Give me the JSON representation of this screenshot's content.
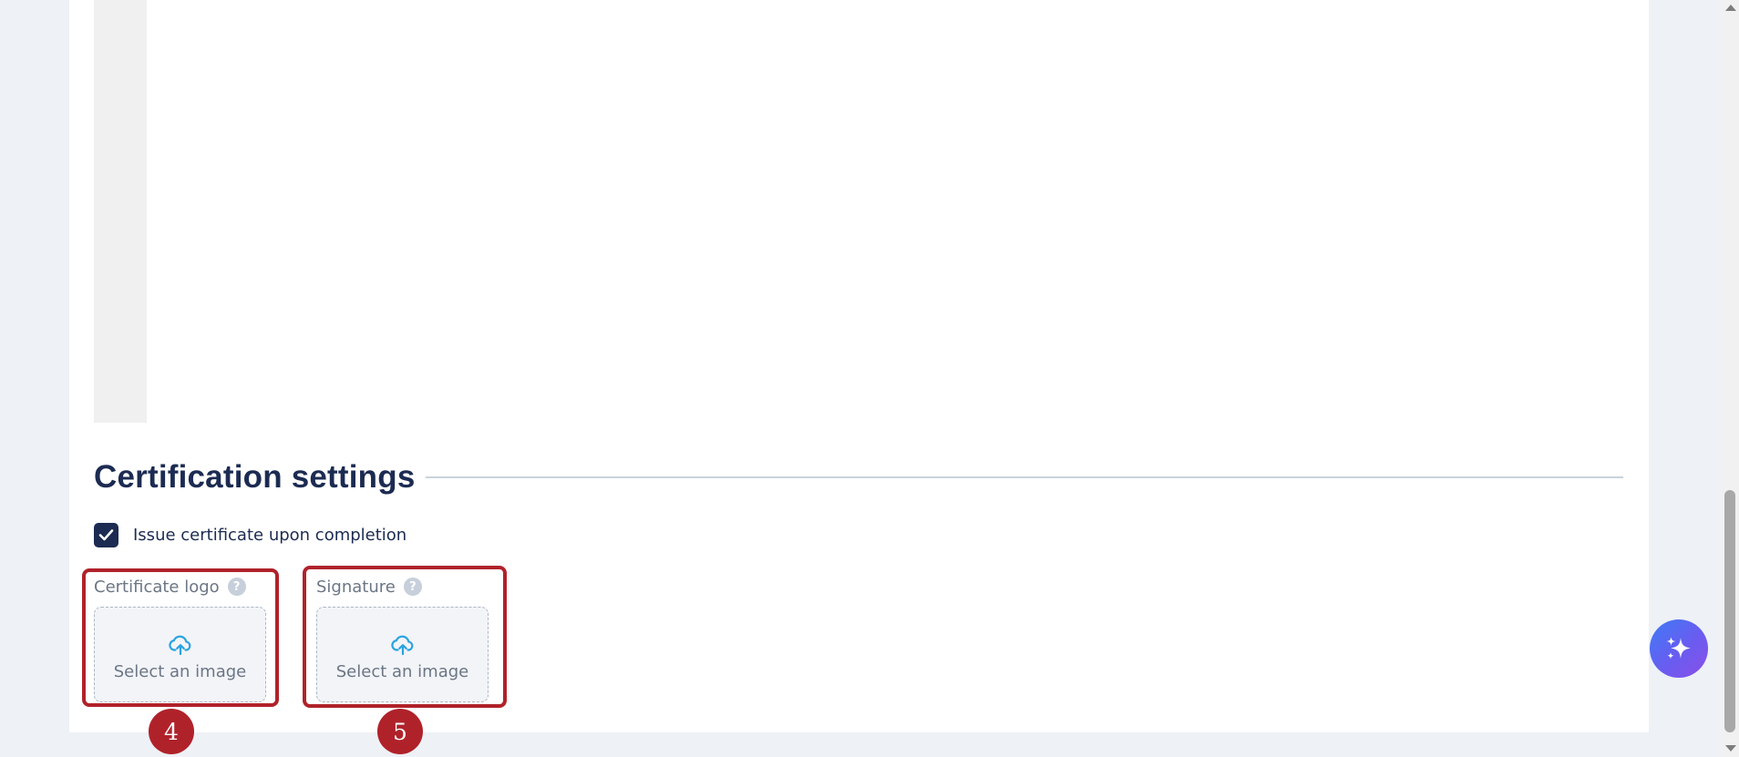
{
  "certification": {
    "section_title": "Certification settings",
    "issue_certificate": {
      "label": "Issue certificate upon completion",
      "checked": true
    },
    "certificate_logo": {
      "label": "Certificate logo",
      "help_glyph": "?",
      "dropzone_text": "Select an image",
      "icon": "cloud-upload-icon"
    },
    "signature": {
      "label": "Signature",
      "help_glyph": "?",
      "dropzone_text": "Select an image",
      "icon": "cloud-upload-icon"
    }
  },
  "annotations": {
    "badge_4": "4",
    "badge_5": "5"
  },
  "assistant": {
    "icon": "sparkle-icon"
  },
  "colors": {
    "accent_navy": "#1c2b52",
    "upload_blue": "#2aa3e0",
    "annotation_red": "#b0222a",
    "assistant_gradient_start": "#3d7bf5",
    "assistant_gradient_end": "#8a4fe8"
  }
}
